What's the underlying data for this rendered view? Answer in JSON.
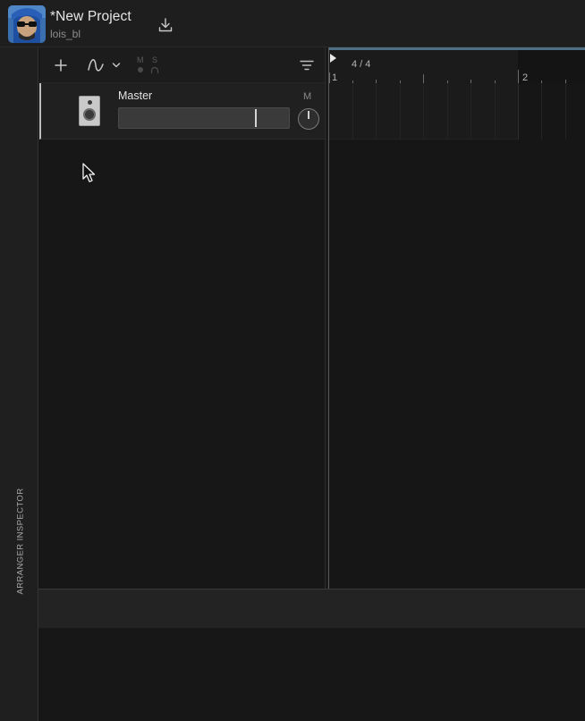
{
  "project": {
    "title": "*New Project",
    "user": "lois_bl"
  },
  "sidebar": {
    "inspector_label": "ARRANGER INSPECTOR"
  },
  "toolbar": {
    "mute_letter": "M",
    "solo_letter": "S",
    "icons": [
      "plus-icon",
      "automation-curve-icon",
      "chevron-down-icon",
      "filter-icon"
    ]
  },
  "tracks": [
    {
      "name": "Master",
      "mute_label": "M",
      "volume_level": 0.8
    }
  ],
  "timeline": {
    "time_signature": "4 / 4",
    "bars": [
      "1",
      "2"
    ]
  },
  "colors": {
    "accent": "#4f6f85",
    "background": "#151515",
    "panel": "#1e1e1e"
  }
}
